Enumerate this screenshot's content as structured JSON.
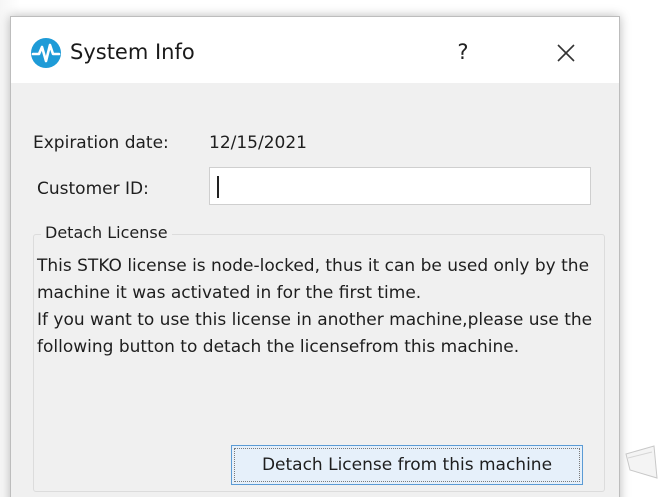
{
  "window": {
    "title": "System Info",
    "help_label": "?",
    "close_label": "✕",
    "icon": "app-logo-icon"
  },
  "info": {
    "expiration_label": "Expiration date:",
    "expiration_value": "12/15/2021",
    "customer_id_label": "Customer ID:",
    "customer_id_value": ""
  },
  "detach_group": {
    "title": "Detach License",
    "paragraph_1": "This STKO license is node-locked, thus it can be used only by the machine it was activated in for the first time.",
    "paragraph_2": "If you want to use this license in another machine,please use the following button to detach the licensefrom this machine.",
    "button_label": "Detach License from this machine"
  },
  "colors": {
    "dialog_bg": "#f0f0f0",
    "titlebar_bg": "#ffffff",
    "icon_blue": "#1e9bd7",
    "button_border": "#5b9bd5",
    "button_bg": "#e6f0fa"
  }
}
